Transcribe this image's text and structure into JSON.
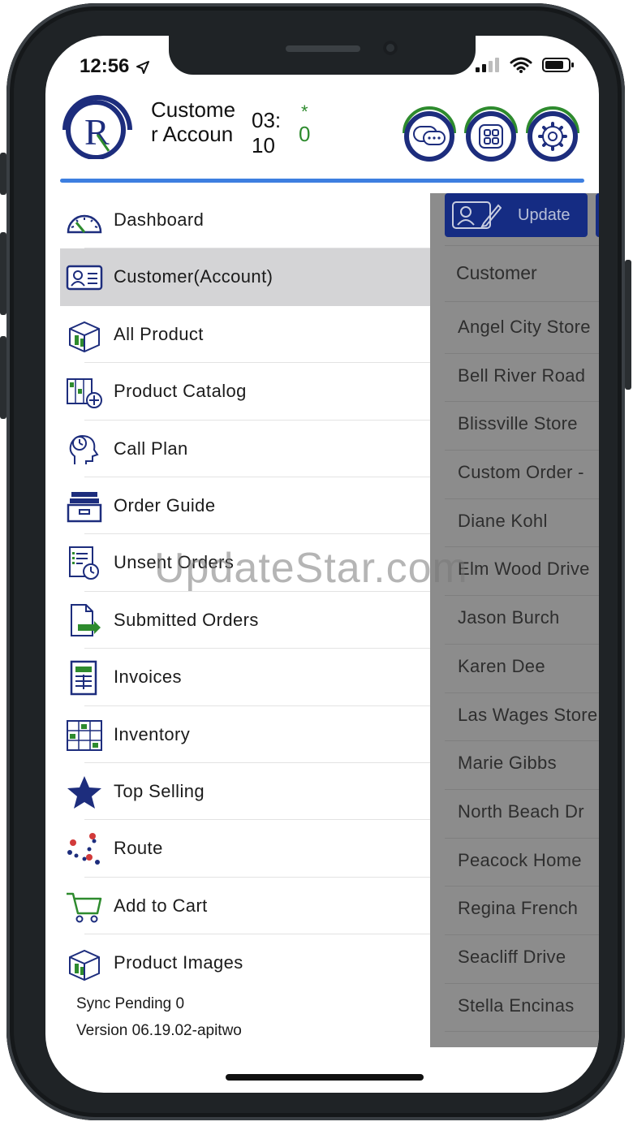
{
  "status": {
    "time": "12:56"
  },
  "header": {
    "title": "Customer Accoun",
    "timer": "03:10",
    "asterisk": "*",
    "count": "0"
  },
  "content": {
    "update_label": "Update",
    "column_header": "Customer",
    "customers": [
      "Angel City Store",
      "Bell River Road",
      "Blissville Store",
      "Custom Order -",
      "Diane Kohl",
      "Elm Wood Drive",
      "Jason Burch",
      "Karen Dee",
      "Las Wages Store",
      "Marie Gibbs",
      "North Beach Dr",
      "Peacock Home",
      "Regina French",
      "Seacliff Drive",
      "Stella Encinas"
    ]
  },
  "menu": {
    "items": [
      {
        "label": "Dashboard",
        "icon": "dashboard-gauge-icon"
      },
      {
        "label": "Customer(Account)",
        "icon": "customer-card-icon",
        "active": true
      },
      {
        "label": "All Product",
        "icon": "product-box-icon"
      },
      {
        "label": "Product Catalog",
        "icon": "catalog-icon"
      },
      {
        "label": "Call Plan",
        "icon": "call-plan-head-icon"
      },
      {
        "label": "Order Guide",
        "icon": "order-guide-drawer-icon"
      },
      {
        "label": "Unsent Orders",
        "icon": "unsent-orders-clock-icon"
      },
      {
        "label": "Submitted Orders",
        "icon": "submitted-orders-arrow-icon"
      },
      {
        "label": "Invoices",
        "icon": "invoice-icon"
      },
      {
        "label": "Inventory",
        "icon": "inventory-shelf-icon"
      },
      {
        "label": "Top Selling",
        "icon": "star-icon"
      },
      {
        "label": "Route",
        "icon": "route-pins-icon"
      },
      {
        "label": "Add to Cart",
        "icon": "cart-icon"
      },
      {
        "label": "Product Images",
        "icon": "product-images-icon"
      }
    ],
    "sync_text": "Sync Pending 0",
    "version_text": "Version 06.19.02-apitwo"
  },
  "watermark": "UpdateStar.com",
  "colors": {
    "accent_blue": "#3d7fe0",
    "navy": "#152c83",
    "green": "#2e8b2e",
    "overlay_gray": "#8c8c8c"
  }
}
